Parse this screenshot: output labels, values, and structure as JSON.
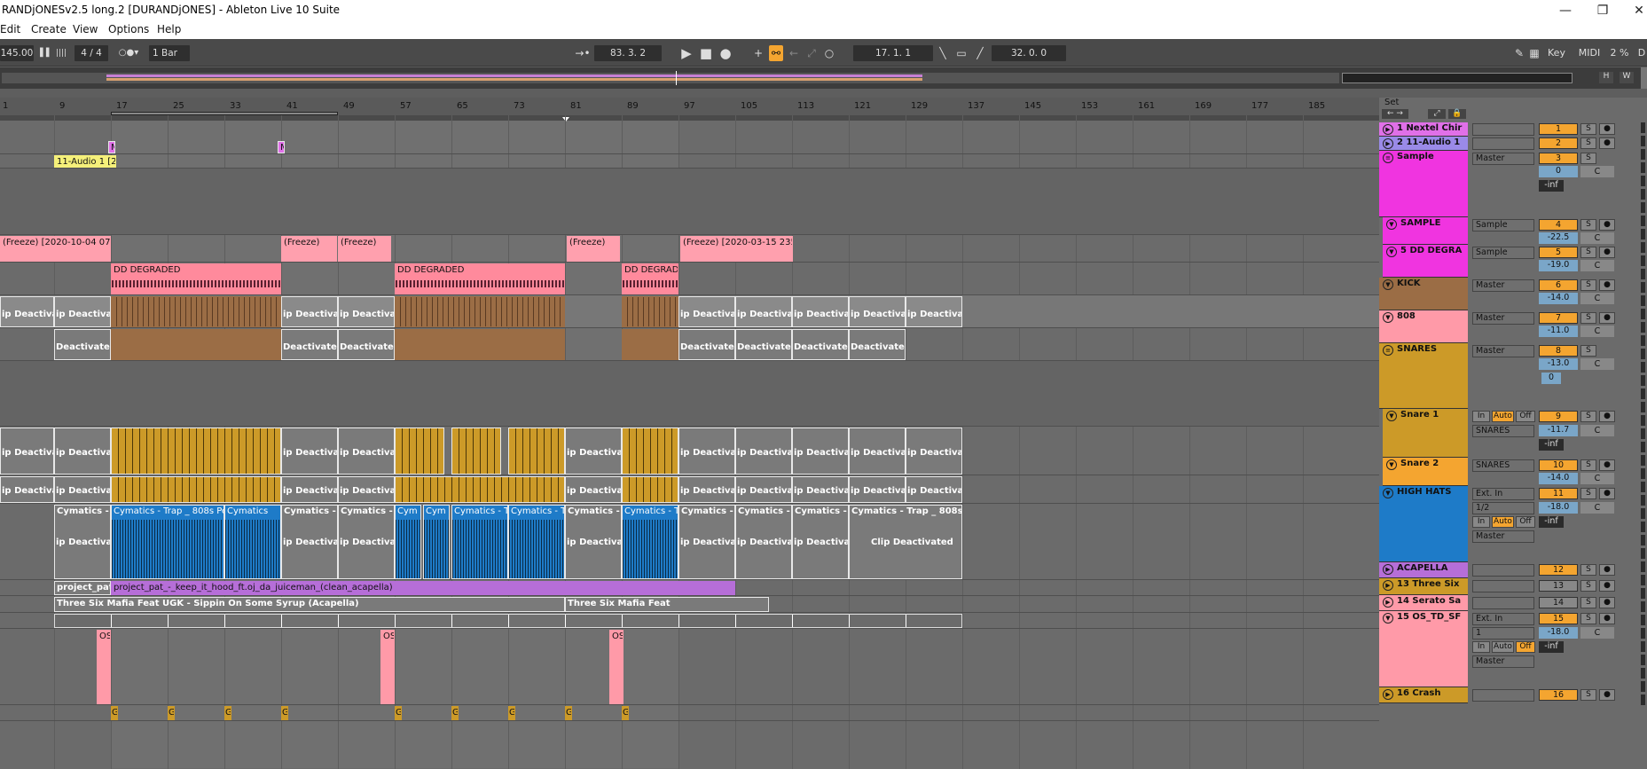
{
  "window": {
    "title": "RANDjONESv2.5 long.2  [DURANDjONES] - Ableton Live 10 Suite",
    "min": "—",
    "max": "❐",
    "close": "✕"
  },
  "menu": [
    "Edit",
    "Create",
    "View",
    "Options",
    "Help"
  ],
  "transport": {
    "tempo": "145.00",
    "signature": "4 / 4",
    "quantize": "1 Bar",
    "position": "83.  3.  2",
    "loop_start": "17.  1.  1",
    "loop_length": "32.  0.  0",
    "key": "Key",
    "midi": "MIDI",
    "cpu": "2 %",
    "d": "D"
  },
  "overview": {
    "h": "H",
    "w": "W"
  },
  "ruler": [
    "1",
    "9",
    "17",
    "25",
    "33",
    "41",
    "49",
    "57",
    "65",
    "73",
    "81",
    "89",
    "97",
    "105",
    "113",
    "121",
    "129",
    "137",
    "145",
    "153",
    "161",
    "169",
    "177",
    "185"
  ],
  "set": {
    "label": "Set"
  },
  "clips": {
    "audio1": "11-Audio 1 [20",
    "freeze1": "(Freeze) [2020-10-04 074",
    "freeze2": "(Freeze)",
    "freeze3": "(Freeze)",
    "freeze4": "(Freeze)",
    "freeze5": "(Freeze) [2020-03-15 235",
    "dd": "DD DEGRADED",
    "dd2": "DD DEGRADE",
    "deact": "ip Deactivate",
    "deact2": "Deactivate",
    "deact3": "Clip Deactivated",
    "cym1": "Cymatics - T",
    "cym2": "Cymatics - Trap _ 808s Percu",
    "cym3": "Cymatics",
    "cym4": "Cym",
    "cym5": "Cymatics - Trap _ 808s Pe",
    "pp1": "project_pat",
    "pp2": "project_pat_-_keep_it_hood_ft.oj_da_juiceman_(clean_acapella)",
    "tsm1": "Three Six Mafia Feat UGK - Sippin On Some Syrup (Acapella)",
    "tsm2": "Three Six Mafia Feat",
    "os": "OS",
    "g": "G",
    "m": "M"
  },
  "tracks": [
    {
      "name": "1 Nextel Chir",
      "num": "1",
      "color": "#e070e8"
    },
    {
      "name": "2 11-Audio 1",
      "num": "2",
      "color": "#9a8ae8"
    },
    {
      "name": "Sample",
      "num": "3",
      "color": "#f034e0",
      "io": "Master",
      "vol": "0",
      "pan": "C",
      "inf": "-inf"
    },
    {
      "name": "SAMPLE",
      "num": "4",
      "color": "#f034e0",
      "io": "Sample",
      "vol": "-22.5",
      "pan": "C"
    },
    {
      "name": "5 DD DEGRA",
      "num": "5",
      "color": "#f034e0",
      "io": "Sample",
      "vol": "-19.0",
      "pan": "C"
    },
    {
      "name": "KICK",
      "num": "6",
      "color": "#9b6d45",
      "io": "Master",
      "vol": "-14.0",
      "pan": "C"
    },
    {
      "name": "808",
      "num": "7",
      "color": "#ff9aa8",
      "io": "Master",
      "vol": "-11.0",
      "pan": "C"
    },
    {
      "name": "SNARES",
      "num": "8",
      "color": "#cc9a28",
      "io": "Master",
      "vol": "-13.0",
      "pan": "C",
      "extra": "0"
    },
    {
      "name": "Snare 1",
      "num": "9",
      "color": "#cc9a28",
      "in": "In",
      "auto": "Auto",
      "off": "Off",
      "io": "SNARES",
      "vol": "-11.7",
      "pan": "C",
      "inf": "-inf"
    },
    {
      "name": "Snare 2",
      "num": "10",
      "color": "#f4a530",
      "io": "SNARES",
      "vol": "-14.0",
      "pan": "C"
    },
    {
      "name": "HIGH HATS",
      "num": "11",
      "color": "#1e7bc8",
      "io": "Ext. In",
      "io2": "1/2",
      "vol": "-18.0",
      "pan": "C",
      "in": "In",
      "auto": "Auto",
      "off": "Off",
      "inf": "-inf",
      "io3": "Master"
    },
    {
      "name": "ACAPELLA",
      "num": "12",
      "color": "#b66ed8"
    },
    {
      "name": "13 Three Six",
      "num": "13",
      "color": "#cc9a28"
    },
    {
      "name": "14 Serato Sa",
      "num": "14",
      "color": "#ff9aa8"
    },
    {
      "name": "15 OS_TD_SF",
      "num": "15",
      "color": "#ff9aa8",
      "io": "Ext. In",
      "io2": "1",
      "vol": "-18.0",
      "pan": "C",
      "in": "In",
      "auto": "Auto",
      "off": "Off",
      "inf": "-inf",
      "io3": "Master"
    },
    {
      "name": "16 Crash",
      "num": "16",
      "color": "#cc9a28"
    }
  ],
  "btn": {
    "s": "S",
    "rec": "●"
  }
}
